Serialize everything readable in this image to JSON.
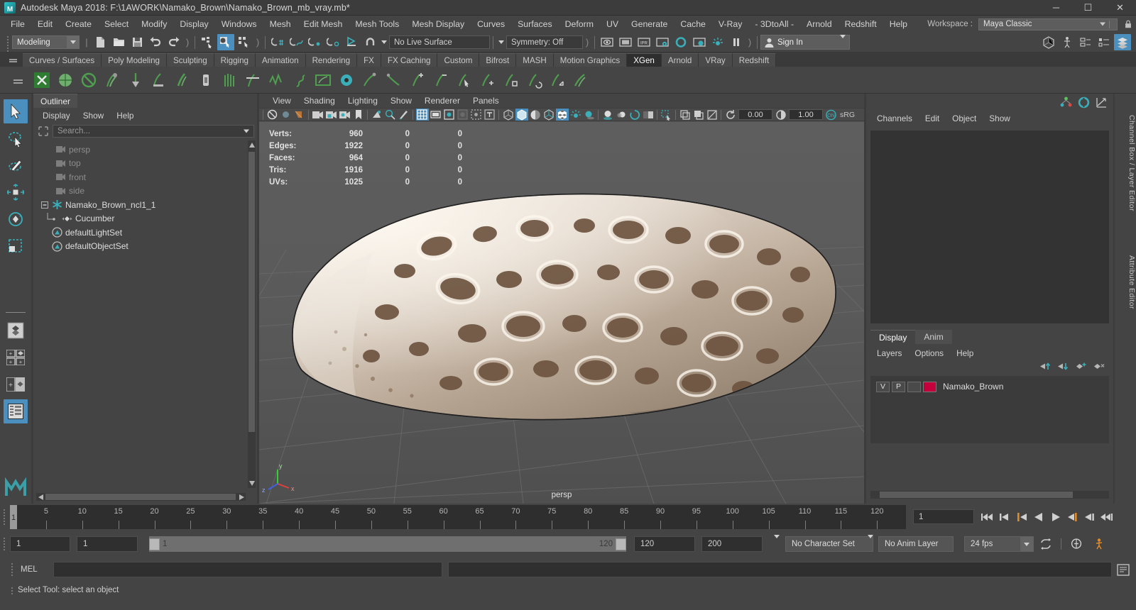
{
  "titlebar": {
    "title": "Autodesk Maya 2018: F:\\1AWORK\\Namako_Brown\\Namako_Brown_mb_vray.mb*",
    "logo": "maya-logo",
    "minimize": "─",
    "maximize": "☐",
    "close": "✕"
  },
  "menubar": {
    "items": [
      "File",
      "Edit",
      "Create",
      "Select",
      "Modify",
      "Display",
      "Windows",
      "Mesh",
      "Edit Mesh",
      "Mesh Tools",
      "Mesh Display",
      "Curves",
      "Surfaces",
      "Deform",
      "UV",
      "Generate",
      "Cache",
      "V-Ray",
      "- 3DtoAll -",
      "Arnold",
      "Redshift",
      "Help"
    ],
    "workspace_label": "Workspace :",
    "workspace_value": "Maya Classic"
  },
  "statusline": {
    "mode": "Modeling",
    "live_surface": "No Live Surface",
    "symmetry": "Symmetry: Off",
    "signin": "Sign In",
    "icons": [
      "new-scene-icon",
      "open-scene-icon",
      "save-scene-icon",
      "undo-icon",
      "redo-icon",
      "select-by-hierarchy-icon",
      "select-by-object-icon",
      "select-by-component-icon",
      "snap-to-grid-icon",
      "snap-to-curve-icon",
      "snap-to-point-icon",
      "snap-to-projected-center-icon",
      "snap-to-view-plane-icon",
      "magnet-icon",
      "render-view-icon",
      "render-region-icon",
      "ipr-render-icon",
      "render-settings-icon",
      "hypershade-icon",
      "render-setup-icon",
      "light-editor-icon",
      "pause-icon",
      "show-hide-modeling-toolkit-icon",
      "show-hide-hud-icon",
      "show-hide-attribute-editor-icon",
      "show-hide-tool-settings-icon",
      "show-hide-channel-box-icon"
    ]
  },
  "shelf": {
    "tabs": [
      "Curves / Surfaces",
      "Poly Modeling",
      "Sculpting",
      "Rigging",
      "Animation",
      "Rendering",
      "FX",
      "FX Caching",
      "Custom",
      "Bifrost",
      "MASH",
      "Motion Graphics",
      "XGen",
      "Arnold",
      "VRay",
      "Redshift"
    ],
    "active_tab": "XGen",
    "icon_count": 24
  },
  "toolbox": {
    "tools": [
      {
        "name": "select-tool",
        "selected": true
      },
      {
        "name": "lasso-select-tool",
        "selected": false
      },
      {
        "name": "paint-select-tool",
        "selected": false
      },
      {
        "name": "move-tool",
        "selected": false
      },
      {
        "name": "rotate-tool",
        "selected": false
      },
      {
        "name": "scale-tool",
        "selected": false
      },
      {
        "name": "last-tool-used",
        "selected": false
      },
      {
        "name": "four-view-layout",
        "selected": false
      },
      {
        "name": "persp-outliner-layout",
        "selected": false
      },
      {
        "name": "single-perspective-layout",
        "selected": false
      },
      {
        "name": "outliner-persp-layout",
        "selected": true
      }
    ]
  },
  "outliner": {
    "tab": "Outliner",
    "menus": [
      "Display",
      "Show",
      "Help"
    ],
    "search_placeholder": "Search...",
    "nodes": [
      {
        "label": "persp",
        "icon": "camera-icon",
        "dim": true,
        "indent": 1,
        "expander": false
      },
      {
        "label": "top",
        "icon": "camera-icon",
        "dim": true,
        "indent": 1,
        "expander": false
      },
      {
        "label": "front",
        "icon": "camera-icon",
        "dim": true,
        "indent": 1,
        "expander": false
      },
      {
        "label": "side",
        "icon": "camera-icon",
        "dim": true,
        "indent": 1,
        "expander": false
      },
      {
        "label": "Namako_Brown_ncl1_1",
        "icon": "transform-icon",
        "dim": false,
        "indent": 0,
        "expander": true
      },
      {
        "label": "Cucumber",
        "icon": "mesh-icon",
        "dim": false,
        "indent": 2,
        "expander": false
      },
      {
        "label": "defaultLightSet",
        "icon": "set-icon",
        "dim": false,
        "indent": 1,
        "expander": false
      },
      {
        "label": "defaultObjectSet",
        "icon": "set-icon",
        "dim": false,
        "indent": 1,
        "expander": false
      }
    ]
  },
  "viewport": {
    "menus": [
      "View",
      "Shading",
      "Lighting",
      "Show",
      "Renderer",
      "Panels"
    ],
    "camera_label": "persp",
    "exposure": "0.00",
    "gamma": "1.00",
    "color_management": "sRG",
    "gate_state": "ON",
    "hud": {
      "rows": [
        {
          "label": "Verts:",
          "total": "960",
          "b": "0",
          "c": "0"
        },
        {
          "label": "Edges:",
          "total": "1922",
          "b": "0",
          "c": "0"
        },
        {
          "label": "Faces:",
          "total": "964",
          "b": "0",
          "c": "0"
        },
        {
          "label": "Tris:",
          "total": "1916",
          "b": "0",
          "c": "0"
        },
        {
          "label": "UVs:",
          "total": "1025",
          "b": "0",
          "c": "0"
        }
      ]
    }
  },
  "channelbox": {
    "menus": [
      "Channels",
      "Edit",
      "Object",
      "Show"
    ],
    "tabs": [
      "Display",
      "Anim"
    ],
    "active_tab": "Display",
    "layer_menus": [
      "Layers",
      "Options",
      "Help"
    ],
    "layers": [
      {
        "visibility": "V",
        "playback": "P",
        "type": "",
        "color": "#c4003c",
        "name": "Namako_Brown"
      }
    ]
  },
  "right_tabs": [
    "Channel Box / Layer Editor",
    "Attribute Editor"
  ],
  "timeslider": {
    "tick_labels": [
      "5",
      "10",
      "15",
      "20",
      "25",
      "30",
      "35",
      "40",
      "45",
      "50",
      "55",
      "60",
      "65",
      "70",
      "75",
      "80",
      "85",
      "90",
      "95",
      "100",
      "105",
      "110",
      "115",
      "120"
    ],
    "current_frame": "1",
    "frame_field": "1",
    "playback_buttons": [
      "go-to-start-icon",
      "step-back-frame-icon",
      "step-back-key-icon",
      "play-backwards-icon",
      "play-forwards-icon",
      "step-forward-key-icon",
      "step-forward-frame-icon",
      "go-to-end-icon"
    ]
  },
  "rangeslider": {
    "start_field": "1",
    "playback_start_field": "1",
    "range_start": "1",
    "range_end": "120",
    "playback_end_field": "120",
    "end_field": "200",
    "character_set": "No Character Set",
    "anim_layer": "No Anim Layer",
    "fps": "24 fps",
    "icons": [
      "auto-key-icon",
      "animation-preferences-icon",
      "loop-playback-icon"
    ]
  },
  "commandline": {
    "language_label": "MEL",
    "input_value": "",
    "output_value": "",
    "script_editor_icon": "script-editor-icon"
  },
  "helpline": {
    "message": "Select Tool: select an object"
  },
  "colors": {
    "accent_blue": "#4a8fbd",
    "teal": "#3aafb9",
    "panel_bg": "#444444",
    "dark_bg": "#2e2e2e",
    "orange": "#e08a28",
    "layer_red": "#c4003c"
  }
}
